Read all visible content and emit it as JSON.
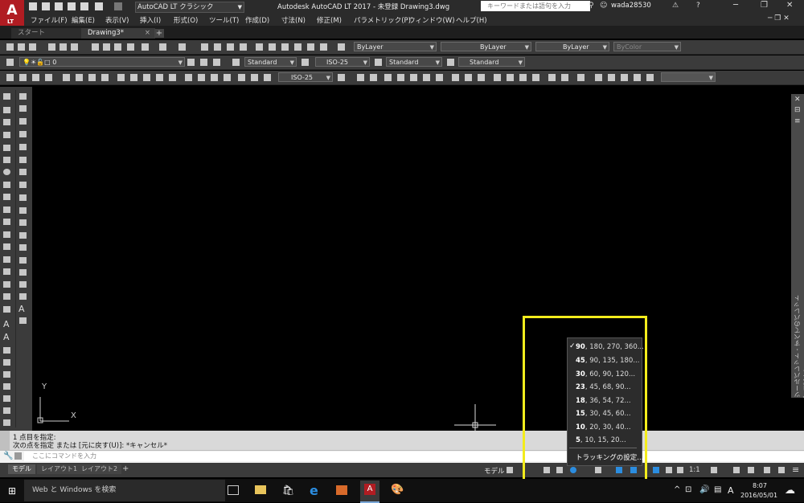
{
  "app": {
    "title": "Autodesk AutoCAD LT 2017 - 未登録    Drawing3.dwg",
    "logo_letter": "A",
    "logo_sub": "LT",
    "workspace": "AutoCAD LT クラシック",
    "search_placeholder": "キーワードまたは語句を入力",
    "user": "wada28530"
  },
  "menu": [
    "ファイル(F)",
    "編集(E)",
    "表示(V)",
    "挿入(I)",
    "形式(O)",
    "ツール(T)",
    "作成(D)",
    "寸法(N)",
    "修正(M)",
    "パラメトリック(P)",
    "ウィンドウ(W)",
    "ヘルプ(H)"
  ],
  "tabs": {
    "start": "スタート",
    "drawing": "Drawing3*",
    "close": "×",
    "add": "+"
  },
  "properties": {
    "color": "ByLayer",
    "linetype": "ByLayer",
    "lineweight": "ByLayer",
    "plotstyle": "ByColor"
  },
  "layer": {
    "current": "0"
  },
  "styles": {
    "text": "Standard",
    "dim": "ISO-25",
    "table": "Standard",
    "mleader": "Standard",
    "dim2": "ISO-25"
  },
  "canvas": {
    "ucs_y": "Y",
    "ucs_x": "X"
  },
  "palette": {
    "label": "ツールパレット - すべてのパレット   プロパティ"
  },
  "command": {
    "line1": "1 点目を指定:",
    "line2": "次の点を指定 または [元に戻す(U)]: *キャンセル*",
    "placeholder": "ここにコマンドを入力"
  },
  "layout_tabs": [
    "モデル",
    "レイアウト1",
    "レイアウト2"
  ],
  "layout_add": "+",
  "status": {
    "model": "モデル",
    "scale": "1:1"
  },
  "popup": {
    "options": [
      {
        "bold": "90",
        "rest": ", 180, 270, 360...",
        "checked": true
      },
      {
        "bold": "45",
        "rest": ", 90, 135, 180...",
        "checked": false
      },
      {
        "bold": "30",
        "rest": ", 60, 90, 120...",
        "checked": false
      },
      {
        "bold": "23",
        "rest": ", 45, 68, 90...",
        "checked": false
      },
      {
        "bold": "18",
        "rest": ", 36, 54, 72...",
        "checked": false
      },
      {
        "bold": "15",
        "rest": ", 30, 45, 60...",
        "checked": false
      },
      {
        "bold": "10",
        "rest": ", 20, 30, 40...",
        "checked": false
      },
      {
        "bold": "5",
        "rest": ", 10, 15, 20...",
        "checked": false
      }
    ],
    "settings": "トラッキングの設定...",
    "check": "✓"
  },
  "taskbar": {
    "search": "Web と Windows を検索",
    "time": "8:07",
    "date": "2016/05/01",
    "ime": "A"
  },
  "colors": {
    "highlight": "#f3ec1c",
    "logo": "#b01c22"
  }
}
